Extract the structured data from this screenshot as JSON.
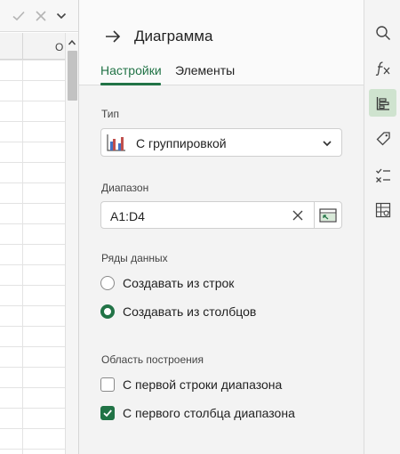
{
  "sheet": {
    "column_letter": "O"
  },
  "panel": {
    "title": "Диаграмма",
    "tabs": [
      {
        "label": "Настройки",
        "active": true
      },
      {
        "label": "Элементы",
        "active": false
      }
    ]
  },
  "type_section": {
    "label": "Тип",
    "selected": "С группировкой",
    "icon": "clustered-column-chart-icon"
  },
  "range_section": {
    "label": "Диапазон",
    "value": "A1:D4"
  },
  "series_section": {
    "label": "Ряды данных",
    "options": [
      {
        "label": "Создавать из строк",
        "checked": false
      },
      {
        "label": "Создавать из столбцов",
        "checked": true
      }
    ]
  },
  "plot_area_section": {
    "label": "Область построения",
    "options": [
      {
        "label": "С первой строки диапазона",
        "checked": false
      },
      {
        "label": "С первого столбца диапазона",
        "checked": true
      }
    ]
  },
  "rail": {
    "items": [
      "search-icon",
      "function-icon",
      "chart-settings-icon",
      "tag-icon",
      "checklist-icon",
      "table-settings-icon"
    ],
    "active": "chart-settings-icon"
  },
  "colors": {
    "accent": "#217346",
    "active_rail_bg": "#cfe3cf"
  }
}
